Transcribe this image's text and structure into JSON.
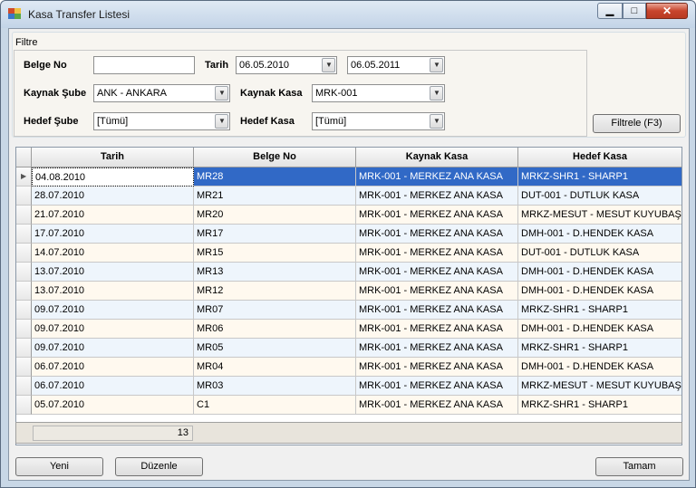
{
  "window": {
    "title": "Kasa Transfer Listesi"
  },
  "filter": {
    "group_title": "Filtre",
    "belge_no_label": "Belge No",
    "belge_no_value": "",
    "tarih_label": "Tarih",
    "tarih_from": "06.05.2010",
    "tarih_to": "06.05.2011",
    "kaynak_sube_label": "Kaynak Şube",
    "kaynak_sube_value": "ANK - ANKARA",
    "kaynak_kasa_label": "Kaynak Kasa",
    "kaynak_kasa_value": "MRK-001",
    "hedef_sube_label": "Hedef Şube",
    "hedef_sube_value": "[Tümü]",
    "hedef_kasa_label": "Hedef Kasa",
    "hedef_kasa_value": "[Tümü]",
    "button_label": "Filtrele (F3)"
  },
  "grid": {
    "columns": [
      "Tarih",
      "Belge No",
      "Kaynak Kasa",
      "Hedef Kasa"
    ],
    "rows": [
      [
        "04.08.2010",
        "MR28",
        "MRK-001 - MERKEZ ANA KASA",
        "MRKZ-SHR1 - SHARP1"
      ],
      [
        "28.07.2010",
        "MR21",
        "MRK-001 - MERKEZ ANA KASA",
        "DUT-001 - DUTLUK KASA"
      ],
      [
        "21.07.2010",
        "MR20",
        "MRK-001 - MERKEZ ANA KASA",
        "MRKZ-MESUT - MESUT KUYUBAŞI"
      ],
      [
        "17.07.2010",
        "MR17",
        "MRK-001 - MERKEZ ANA KASA",
        "DMH-001 - D.HENDEK KASA"
      ],
      [
        "14.07.2010",
        "MR15",
        "MRK-001 - MERKEZ ANA KASA",
        "DUT-001 - DUTLUK KASA"
      ],
      [
        "13.07.2010",
        "MR13",
        "MRK-001 - MERKEZ ANA KASA",
        "DMH-001 - D.HENDEK KASA"
      ],
      [
        "13.07.2010",
        "MR12",
        "MRK-001 - MERKEZ ANA KASA",
        "DMH-001 - D.HENDEK KASA"
      ],
      [
        "09.07.2010",
        "MR07",
        "MRK-001 - MERKEZ ANA KASA",
        "MRKZ-SHR1 - SHARP1"
      ],
      [
        "09.07.2010",
        "MR06",
        "MRK-001 - MERKEZ ANA KASA",
        "DMH-001 - D.HENDEK KASA"
      ],
      [
        "09.07.2010",
        "MR05",
        "MRK-001 - MERKEZ ANA KASA",
        "MRKZ-SHR1 - SHARP1"
      ],
      [
        "06.07.2010",
        "MR04",
        "MRK-001 - MERKEZ ANA KASA",
        "DMH-001 - D.HENDEK KASA"
      ],
      [
        "06.07.2010",
        "MR03",
        "MRK-001 - MERKEZ ANA KASA",
        "MRKZ-MESUT - MESUT KUYUBAŞI"
      ],
      [
        "05.07.2010",
        "C1",
        "MRK-001 - MERKEZ ANA KASA",
        "MRKZ-SHR1 - SHARP1"
      ]
    ],
    "count": "13"
  },
  "buttons": {
    "yeni": "Yeni",
    "duzenle": "Düzenle",
    "tamam": "Tamam"
  },
  "colors": {
    "selection": "#3169c6",
    "alt_row": "#fff9ef",
    "even_row": "#eef5fc"
  }
}
